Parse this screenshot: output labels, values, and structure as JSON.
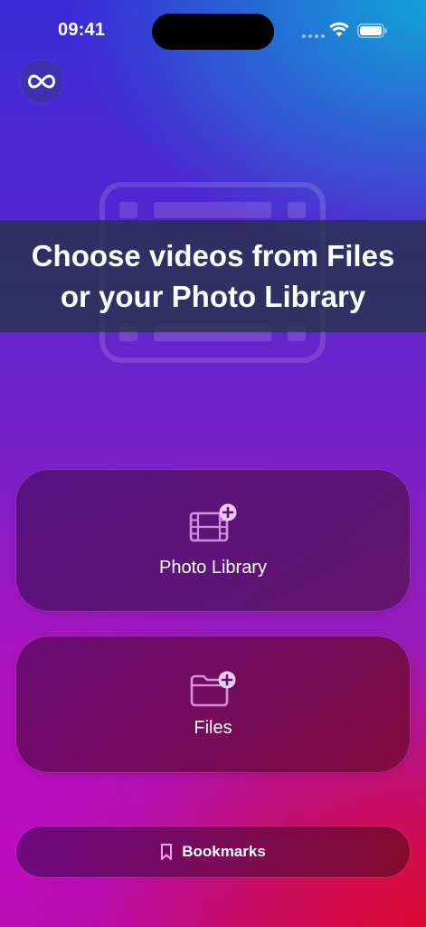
{
  "status_bar": {
    "time": "09:41"
  },
  "header": {
    "infinity_icon": "infinity-icon"
  },
  "banner": {
    "title": "Choose videos from Files or your Photo Library"
  },
  "sources": [
    {
      "label": "Photo Library",
      "icon": "film-plus-icon"
    },
    {
      "label": "Files",
      "icon": "folder-plus-icon"
    }
  ],
  "bookmarks": {
    "label": "Bookmarks",
    "icon": "bookmark-icon"
  },
  "colors": {
    "accent_icon": "#d98ee0",
    "text": "#ffffff"
  }
}
